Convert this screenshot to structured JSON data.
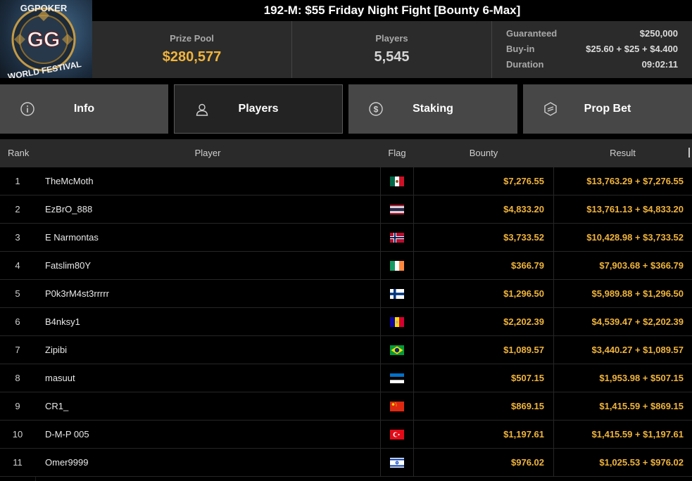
{
  "title": "192-M: $55 Friday Night Fight [Bounty 6-Max]",
  "logo": {
    "top_text": "GGPOKER",
    "center_text": "GG",
    "bottom_text": "WORLD FESTIVAL"
  },
  "stats": {
    "prize_pool_label": "Prize Pool",
    "prize_pool_value": "$280,577",
    "players_label": "Players",
    "players_value": "5,545",
    "guaranteed_label": "Guaranteed",
    "guaranteed_value": "$250,000",
    "buyin_label": "Buy-in",
    "buyin_value": "$25.60 + $25 + $4.400",
    "duration_label": "Duration",
    "duration_value": "09:02:11"
  },
  "tabs": [
    {
      "label": "Info",
      "icon": "info-icon",
      "active": false
    },
    {
      "label": "Players",
      "icon": "user-icon",
      "active": true
    },
    {
      "label": "Staking",
      "icon": "dollar-coin-icon",
      "active": false
    },
    {
      "label": "Prop Bet",
      "icon": "prop-bet-icon",
      "active": false
    }
  ],
  "table": {
    "headers": {
      "rank": "Rank",
      "player": "Player",
      "flag": "Flag",
      "bounty": "Bounty",
      "result": "Result"
    },
    "rows": [
      {
        "rank": "1",
        "player": "TheMcMoth",
        "flag": "mexico",
        "bounty": "$7,276.55",
        "result": "$13,763.29 + $7,276.55"
      },
      {
        "rank": "2",
        "player": "EzBrO_888",
        "flag": "thailand",
        "bounty": "$4,833.20",
        "result": "$13,761.13 + $4,833.20"
      },
      {
        "rank": "3",
        "player": "E Narmontas",
        "flag": "norway",
        "bounty": "$3,733.52",
        "result": "$10,428.98 + $3,733.52"
      },
      {
        "rank": "4",
        "player": "Fatslim80Y",
        "flag": "ireland",
        "bounty": "$366.79",
        "result": "$7,903.68 + $366.79"
      },
      {
        "rank": "5",
        "player": "P0k3rM4st3rrrrr",
        "flag": "finland",
        "bounty": "$1,296.50",
        "result": "$5,989.88 + $1,296.50"
      },
      {
        "rank": "6",
        "player": "B4nksy1",
        "flag": "andorra",
        "bounty": "$2,202.39",
        "result": "$4,539.47 + $2,202.39"
      },
      {
        "rank": "7",
        "player": "Zipibi",
        "flag": "brazil",
        "bounty": "$1,089.57",
        "result": "$3,440.27 + $1,089.57"
      },
      {
        "rank": "8",
        "player": "masuut",
        "flag": "estonia",
        "bounty": "$507.15",
        "result": "$1,953.98 + $507.15"
      },
      {
        "rank": "9",
        "player": "CR1_",
        "flag": "china",
        "bounty": "$869.15",
        "result": "$1,415.59 + $869.15"
      },
      {
        "rank": "10",
        "player": "D-M-P 005",
        "flag": "turkey",
        "bounty": "$1,197.61",
        "result": "$1,415.59 + $1,197.61"
      },
      {
        "rank": "11",
        "player": "Omer9999",
        "flag": "israel",
        "bounty": "$976.02",
        "result": "$1,025.53 + $976.02"
      }
    ]
  },
  "colors": {
    "accent_gold": "#f0b43c",
    "tab_bg": "#474747",
    "tab_active_bg": "#232323",
    "header_bg": "#2b2b2b"
  }
}
